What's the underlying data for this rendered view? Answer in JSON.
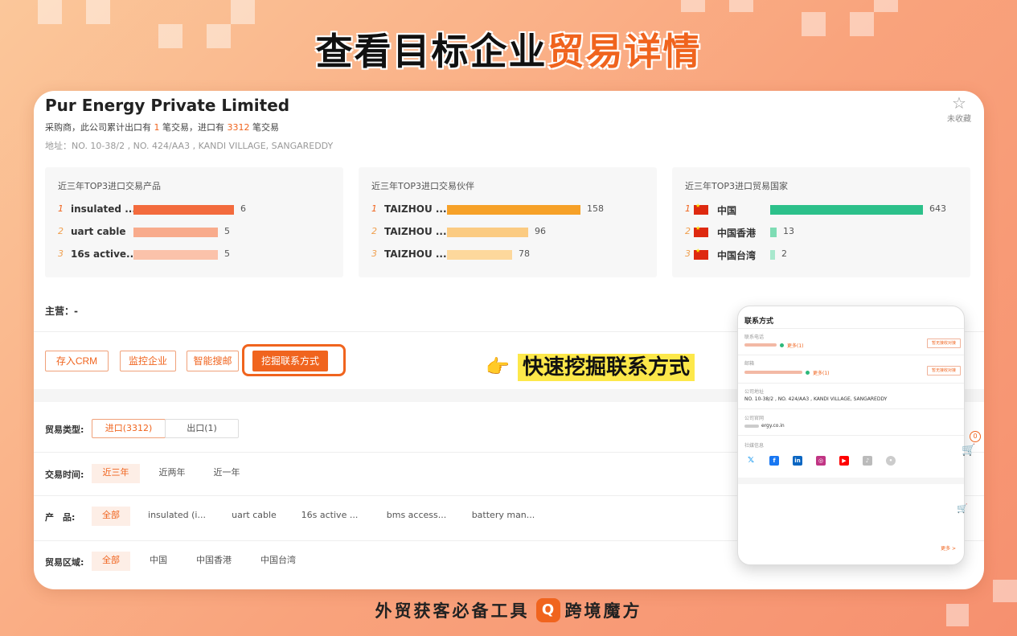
{
  "headline": {
    "part1": "查看目标企业",
    "part2": "贸易详情"
  },
  "company": {
    "name": "Pur Energy Private Limited",
    "summary_pre": "采购商，此公司累计出口有 ",
    "export_count": "1",
    "summary_mid": " 笔交易，进口有 ",
    "import_count": "3312",
    "summary_post": " 笔交易",
    "address": "地址：NO. 10-38/2 , NO. 424/AA3 , KANDI VILLAGE, SANGAREDDY",
    "favorite_label": "未收藏"
  },
  "panels": [
    {
      "title": "近三年TOP3进口交易产品",
      "items": [
        {
          "rank": "1",
          "label": "insulated ...",
          "value": "6",
          "ratio": 1.0,
          "color": "#f36b3d"
        },
        {
          "rank": "2",
          "label": "uart cable",
          "value": "5",
          "ratio": 0.84,
          "color": "#f8ab8c"
        },
        {
          "rank": "3",
          "label": "16s active...",
          "value": "5",
          "ratio": 0.84,
          "color": "#fbc2aa"
        }
      ]
    },
    {
      "title": "近三年TOP3进口交易伙伴",
      "items": [
        {
          "rank": "1",
          "label": "TAIZHOU ...",
          "value": "158",
          "ratio": 1.0,
          "color": "#f6a128"
        },
        {
          "rank": "2",
          "label": "TAIZHOU ...",
          "value": "96",
          "ratio": 0.61,
          "color": "#fbcb82"
        },
        {
          "rank": "3",
          "label": "TAIZHOU ...",
          "value": "78",
          "ratio": 0.49,
          "color": "#fdd89c"
        }
      ]
    },
    {
      "title": "近三年TOP3进口贸易国家",
      "items": [
        {
          "rank": "1",
          "label": "中国",
          "value": "643",
          "ratio": 1.0,
          "color": "#2cc08a"
        },
        {
          "rank": "2",
          "label": "中国香港",
          "value": "13",
          "ratio": 0.04,
          "color": "#7edcb4"
        },
        {
          "rank": "3",
          "label": "中国台湾",
          "value": "2",
          "ratio": 0.03,
          "color": "#a8e8cd"
        }
      ]
    }
  ],
  "main_business": "主营：-",
  "actions": {
    "crm": "存入CRM",
    "monitor": "监控企业",
    "smart_search": "智能搜邮",
    "dig_contact": "挖掘联系方式"
  },
  "filters": {
    "trade_type": {
      "label": "贸易类型:",
      "options": [
        "进口(3312)",
        "出口(1)"
      ]
    },
    "trade_time": {
      "label": "交易时间:",
      "options": [
        "近三年",
        "近两年",
        "近一年"
      ]
    },
    "product": {
      "label": "产　品:",
      "options": [
        "全部",
        "insulated (i...",
        "uart cable",
        "16s active ...",
        "bms access...",
        "battery man..."
      ]
    },
    "region": {
      "label": "贸易区域:",
      "options": [
        "全部",
        "中国",
        "中国香港",
        "中国台湾"
      ]
    }
  },
  "callout": {
    "text": "快速挖掘联系方式",
    "icon": "pointing-hand-icon"
  },
  "contact_popup": {
    "title": "联系方式",
    "phone_label": "联系电话",
    "phone_more": "更多(1)",
    "tag_button": "暂无接收对接",
    "email_label": "邮箱",
    "email_more": "更多(1)",
    "address_label": "公司地址",
    "address_value": "NO. 10-38/2 , NO. 424/AA3 , KANDI VILLAGE, SANGAREDDY",
    "website_label": "公司官网",
    "website_value": "ergy.co.in",
    "social_label": "社媒信息",
    "more": "更多 >"
  },
  "side": {
    "cart_count": "0"
  },
  "footer": {
    "tagline": "外贸获客必备工具",
    "brand": "跨境魔方",
    "logo_glyph": "Q"
  }
}
